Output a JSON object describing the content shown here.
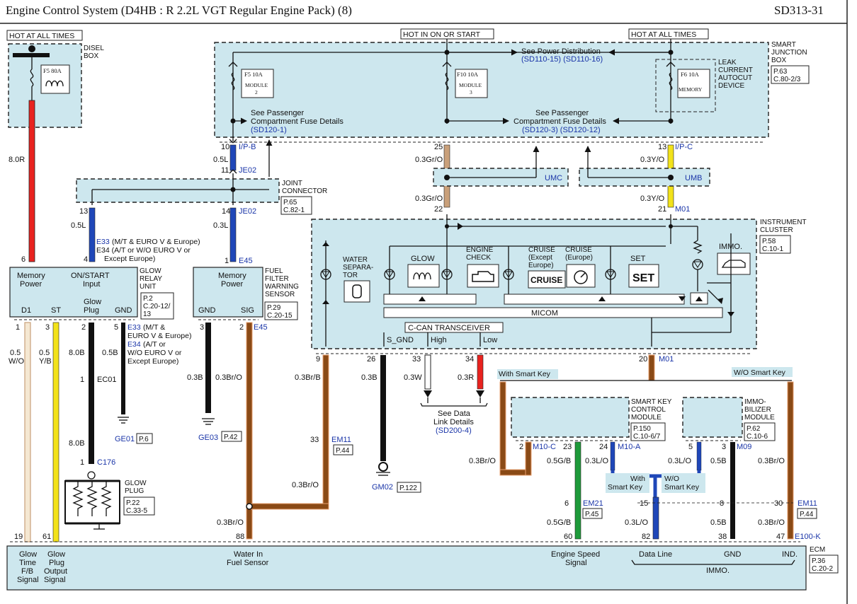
{
  "header": {
    "title": "Engine Control System (D4HB : R 2.2L VGT Regular Engine Pack) (8)",
    "code": "SD313-31"
  },
  "hot_labels": {
    "left": "HOT AT ALL TIMES",
    "middle": "HOT IN ON OR START",
    "right": "HOT AT ALL TIMES"
  },
  "disel_box": {
    "name_line1": "DISEL",
    "name_line2": "BOX",
    "fuse": "F5 80A"
  },
  "smart_junction_box": {
    "name": [
      "SMART",
      "JUNCTION",
      "BOX"
    ],
    "ref": [
      "P.63",
      "C.80-2/3"
    ],
    "fuses": [
      {
        "label": "F5 10A",
        "sub": [
          "MODULE",
          "2"
        ]
      },
      {
        "label": "F10 10A",
        "sub": [
          "MODULE",
          "3"
        ]
      },
      {
        "label": "F6 10A",
        "sub": [
          "MEMORY"
        ]
      }
    ],
    "leak_device": [
      "LEAK",
      "CURRENT",
      "AUTOCUT",
      "DEVICE"
    ],
    "see_power": "See Power Distribution",
    "see_power_refs": "(SD110-15)  (SD110-16)",
    "see_pass_left": [
      "See Passenger",
      "Compartment Fuse Details"
    ],
    "see_pass_left_ref": "(SD120-1)",
    "see_pass_mid": [
      "See Passenger",
      "Compartment Fuse Details"
    ],
    "see_pass_mid_ref": "(SD120-3)  (SD120-12)"
  },
  "connectors": {
    "ipb": "I/P-B",
    "ipc": "I/P-C",
    "je02a": "JE02",
    "je02b": "JE02",
    "umc": "UMC",
    "umb": "UMB",
    "m01a": "M01",
    "m01b": "M01",
    "e45a": "E45",
    "e45b": "E45",
    "ec01": "EC01",
    "c176": "C176",
    "em11a": "EM11",
    "em11b": "EM11",
    "m10c": "M10-C",
    "m10a": "M10-A",
    "m09": "M09",
    "em21": "EM21",
    "e100k": "E100-K",
    "ge01": "GE01",
    "ge03": "GE03",
    "gm02": "GM02"
  },
  "joint_connector": {
    "name": [
      "JOINT",
      "CONNECTOR"
    ],
    "ref": [
      "P.65",
      "C.82-1"
    ]
  },
  "glow_relay": {
    "name": [
      "GLOW",
      "RELAY",
      "UNIT"
    ],
    "ref": [
      "P.2",
      "C.20-12/",
      "13"
    ],
    "mem_power": [
      "Memory",
      "Power"
    ],
    "on_start": [
      "ON/START",
      "Input"
    ],
    "d1": "D1",
    "st": "ST",
    "glow_plug": [
      "Glow",
      "Plug"
    ],
    "gnd": "GND",
    "e33_top": "E33 (M/T & EURO V & Europe)",
    "e34_top": [
      "E34 (A/T or W/O EURO V or",
      "Except Europe)"
    ],
    "e33_bot": [
      "E33 (M/T &",
      "EURO V & Europe)"
    ],
    "e34_bot": [
      "E34 (A/T or",
      "W/O EURO V or",
      "Except Europe)"
    ]
  },
  "fuel_sensor": {
    "name": [
      "FUEL",
      "FILTER",
      "WARNING",
      "SENSOR"
    ],
    "ref": [
      "P.29",
      "C.20-15"
    ],
    "mem_power": [
      "Memory",
      "Power"
    ],
    "gnd": "GND",
    "sig": "SIG"
  },
  "cluster": {
    "name": [
      "INSTRUMENT",
      "CLUSTER"
    ],
    "ref": [
      "P.58",
      "C.10-1"
    ],
    "water": [
      "WATER",
      "SEPARA-",
      "TOR"
    ],
    "glow": "GLOW",
    "engine_check": [
      "ENGINE",
      "CHECK"
    ],
    "cruise1": [
      "CRUISE",
      "(Except",
      "Europe)"
    ],
    "cruise1_icon": "CRUISE",
    "cruise2": [
      "CRUISE",
      "(Europe)"
    ],
    "set": "SET",
    "set_icon": "SET",
    "immo": "IMMO.",
    "micom": "MICOM",
    "ccan": "C-CAN TRANSCEIVER",
    "s_gnd": "S_GND",
    "high": "High",
    "low": "Low"
  },
  "see_data": {
    "lines": [
      "See Data",
      "Link Details"
    ],
    "ref": "(SD200-4)"
  },
  "smart_key": {
    "name": [
      "SMART KEY",
      "CONTROL",
      "MODULE"
    ],
    "ref": [
      "P.150",
      "C.10-6/7"
    ]
  },
  "immobilizer": {
    "name": [
      "IMMO-",
      "BILIZER",
      "MODULE"
    ],
    "ref": [
      "P.62",
      "C.10-6"
    ]
  },
  "tags": {
    "with_smart_key": "With Smart Key",
    "wo_smart_key": "W/O Smart Key",
    "with_smart_key2": [
      "With",
      "Smart Key"
    ],
    "wo_smart_key2": [
      "W/O",
      "Smart Key"
    ]
  },
  "ecm": {
    "name": "ECM",
    "ref": [
      "P.36",
      "C.20-2"
    ],
    "glow_time": [
      "Glow",
      "Time",
      "F/B",
      "Signal"
    ],
    "glow_plug_out": [
      "Glow",
      "Plug",
      "Output",
      "Signal"
    ],
    "water_in": [
      "Water In",
      "Fuel Sensor"
    ],
    "engine_speed": [
      "Engine Speed",
      "Signal"
    ],
    "data_line": "Data Line",
    "gnd": "GND",
    "ind": "IND.",
    "immo": "IMMO."
  },
  "page_refs": {
    "ge01": "P.6",
    "ge03": "P.42",
    "gm02": "P.122",
    "em11_top": "P.44",
    "em11_right": "P.44",
    "em21": "P.45",
    "glow_plug": [
      "P.22",
      "C.33-5"
    ]
  },
  "glow_plug_name": [
    "GLOW",
    "PLUG"
  ],
  "pins": {
    "p10": "10",
    "p11": "11",
    "p13a": "13",
    "p14": "14",
    "p4": "4",
    "p1a": "1",
    "p6": "6",
    "p25": "25",
    "p22": "22",
    "p13b": "13",
    "p21": "21",
    "p1b": "1",
    "p3a": "3",
    "p2a": "2",
    "p5a": "5",
    "p3b": "3",
    "p2b": "2",
    "p1c": "1",
    "p1d": "1",
    "p9": "9",
    "p26": "26",
    "p33": "33",
    "p34": "34",
    "p20": "20",
    "p33b": "33",
    "p2c": "2",
    "p23": "23",
    "p24": "24",
    "p5b": "5",
    "p3c": "3",
    "p6b": "6",
    "p15": "15",
    "p8": "8",
    "p30": "30",
    "p19": "19",
    "p61": "61",
    "p88": "88",
    "p60": "60",
    "p82": "82",
    "p38": "38",
    "p47": "47"
  },
  "wires": {
    "w8r": "8.0R",
    "w05l": "0.5L",
    "w03l": "0.3L",
    "w05l2": "0.5L",
    "w03gro": "0.3Gr/O",
    "w03gro2": "0.3Gr/O",
    "w03yo": "0.3Y/O",
    "w03yo2": "0.3Y/O",
    "w05wo": [
      "0.5",
      "W/O"
    ],
    "w05yb": [
      "0.5",
      "Y/B"
    ],
    "w8b": "8.0B",
    "w8b2": "8.0B",
    "w05b": "0.5B",
    "w03b": "0.3B",
    "w03bro": "0.3Br/O",
    "w03brb": "0.3Br/B",
    "w03bro2": "0.3Br/O",
    "w03bro3": "0.3Br/O",
    "w03b2": "0.3B",
    "w03w": "0.3W",
    "w03r": "0.3R",
    "w03bro4": "0.3Br/O",
    "w05gb": "0.5G/B",
    "w03lo": "0.3L/O",
    "w03lo2": "0.3L/O",
    "w05b2": "0.5B",
    "w03bro5": "0.3Br/O",
    "w05gb2": "0.5G/B",
    "w03lo3": "0.3L/O",
    "w05b3": "0.5B",
    "w03bro6": "0.3Br/O"
  },
  "colors": {
    "red": "#e8231f",
    "blue": "#1f47b8",
    "yellow": "#f2e21a",
    "tan": "#c9a07a",
    "brown": "#8a4a16",
    "green": "#1e9a3a",
    "fill": "#cde7ee"
  }
}
